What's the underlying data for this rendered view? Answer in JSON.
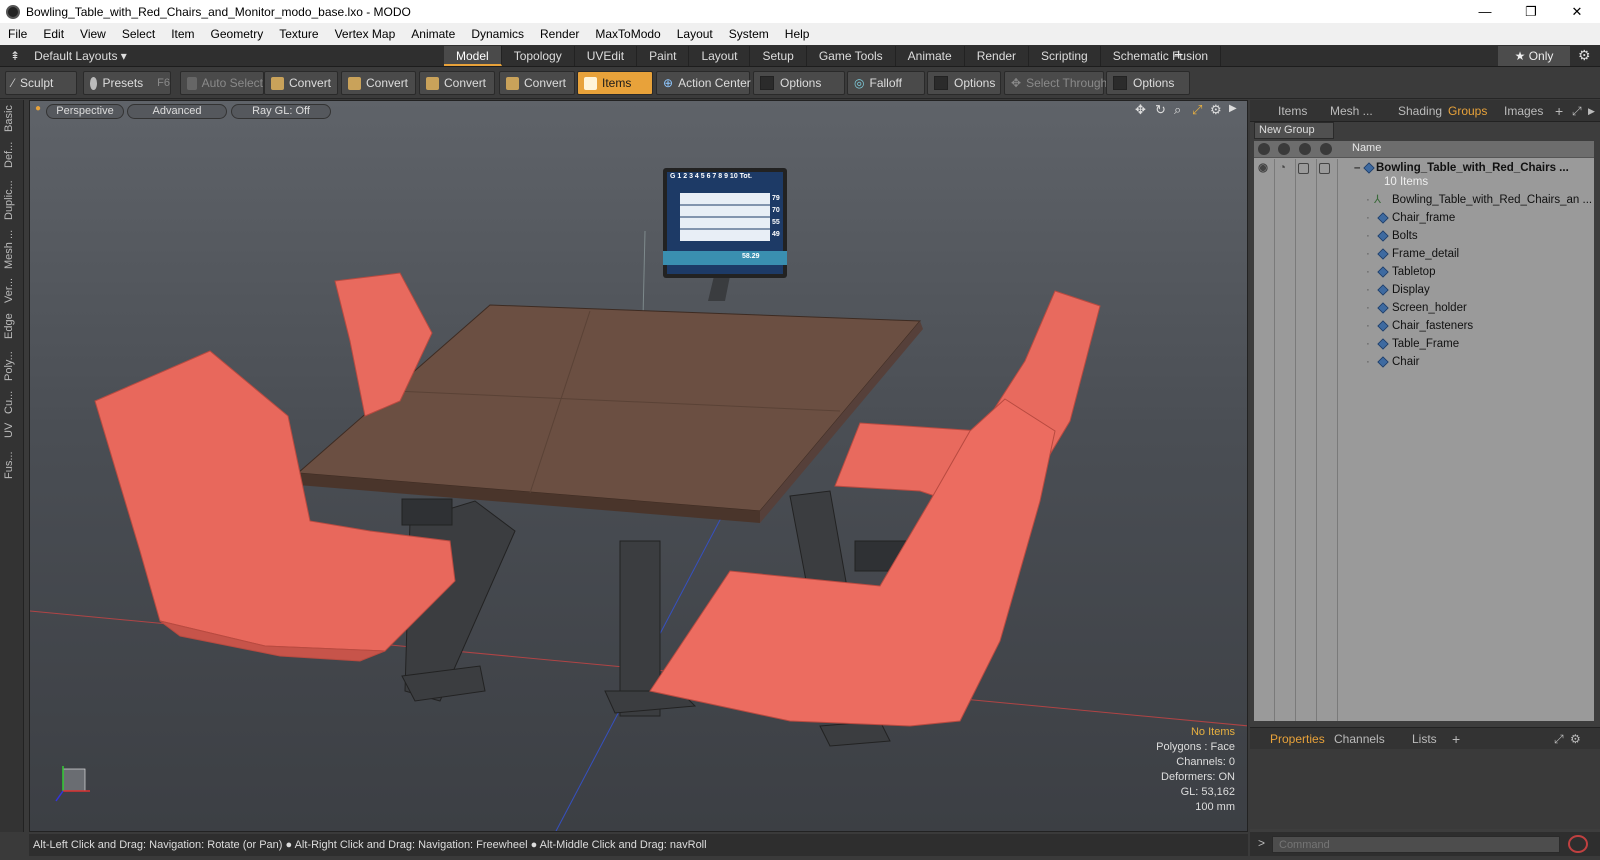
{
  "window": {
    "title": "Bowling_Table_with_Red_Chairs_and_Monitor_modo_base.lxo - MODO",
    "minimize": "—",
    "restore": "❐",
    "close": "✕"
  },
  "menu": [
    "File",
    "Edit",
    "View",
    "Select",
    "Item",
    "Geometry",
    "Texture",
    "Vertex Map",
    "Animate",
    "Dynamics",
    "Render",
    "MaxToModo",
    "Layout",
    "System",
    "Help"
  ],
  "layoutbar": {
    "layout_select": "Default Layouts ▾",
    "tabs": [
      "Model",
      "Topology",
      "UVEdit",
      "Paint",
      "Layout",
      "Setup",
      "Game Tools",
      "Animate",
      "Render",
      "Scripting",
      "Schematic Fusion"
    ],
    "active_tab": "Model",
    "add": "+",
    "only": "★  Only"
  },
  "toolbar": {
    "sculpt": "Sculpt",
    "presets": "Presets",
    "presets_key": "F6",
    "auto_select": "Auto Select",
    "convert1": "Convert",
    "convert2": "Convert",
    "convert3": "Convert",
    "convert4": "Convert",
    "items": "Items",
    "action_center": "Action Center",
    "options1": "Options",
    "falloff": "Falloff",
    "options2": "Options",
    "select_through": "Select Through",
    "options3": "Options"
  },
  "leftstrip": [
    "Basic",
    "Def...",
    "Duplic...",
    "Mesh ...",
    "Ver...",
    "Edge",
    "Poly...",
    "Cu...",
    "UV",
    "Fus..."
  ],
  "viewport": {
    "view_mode": "Perspective",
    "shading": "Advanced",
    "raygl": "Ray GL: Off",
    "info": {
      "items": "No Items",
      "polygons": "Polygons : Face",
      "channels": "Channels: 0",
      "deformers": "Deformers: ON",
      "gl": "GL: 53,162",
      "scale": "100 mm"
    },
    "monitor": {
      "header": "G  1  2  3  4  5  6  7  8  9 10 Tot.",
      "scores": [
        "79",
        "70",
        "55",
        "49"
      ],
      "total": "58.29"
    }
  },
  "statusbar": "Alt-Left Click and Drag: Navigation: Rotate (or Pan) ● Alt-Right Click and Drag: Navigation: Freewheel ● Alt-Middle Click and Drag: navRoll",
  "rightpanel": {
    "tabs": [
      "Items",
      "Mesh ...",
      "Shading",
      "Groups",
      "Images"
    ],
    "active_tab": "Groups",
    "new_group": "New Group",
    "name_col": "Name",
    "root": {
      "name": "Bowling_Table_with_Red_Chairs ...",
      "count": "10 Items"
    },
    "children": [
      "Bowling_Table_with_Red_Chairs_an ...",
      "Chair_frame",
      "Bolts",
      "Frame_detail",
      "Tabletop",
      "Display",
      "Screen_holder",
      "Chair_fasteners",
      "Table_Frame",
      "Chair"
    ],
    "prop_tabs": [
      "Properties",
      "Channels",
      "Lists"
    ],
    "command_placeholder": "Command"
  }
}
